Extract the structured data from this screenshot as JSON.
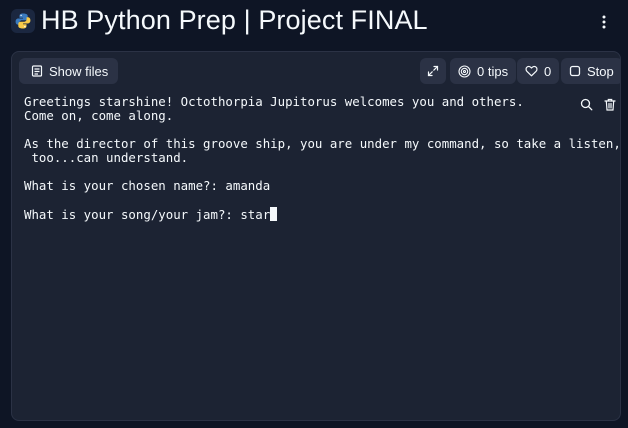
{
  "header": {
    "title": "HB Python Prep | Project FINAL",
    "logo_icon": "python-logo-icon",
    "menu_icon": "more-vertical-icon"
  },
  "toolbar": {
    "show_files_label": "Show files",
    "tips_label": "0 tips",
    "likes_count": "0",
    "stop_label": "Stop"
  },
  "console": {
    "lines": [
      "Greetings starshine! Octothorpia Jupitorus welcomes you and others.",
      "Come on, come along.",
      "",
      "As the director of this groove ship, you are under my command, so take a listen, so you",
      " too...can understand.",
      "",
      "What is your chosen name?: amanda",
      "",
      "What is your song/your jam?: star"
    ]
  },
  "colors": {
    "background": "#0e1525",
    "panel": "#1c2333",
    "button": "#2b3245",
    "text": "#f5f9fc",
    "python_blue": "#3b7bbf",
    "python_yellow": "#f7c948"
  }
}
